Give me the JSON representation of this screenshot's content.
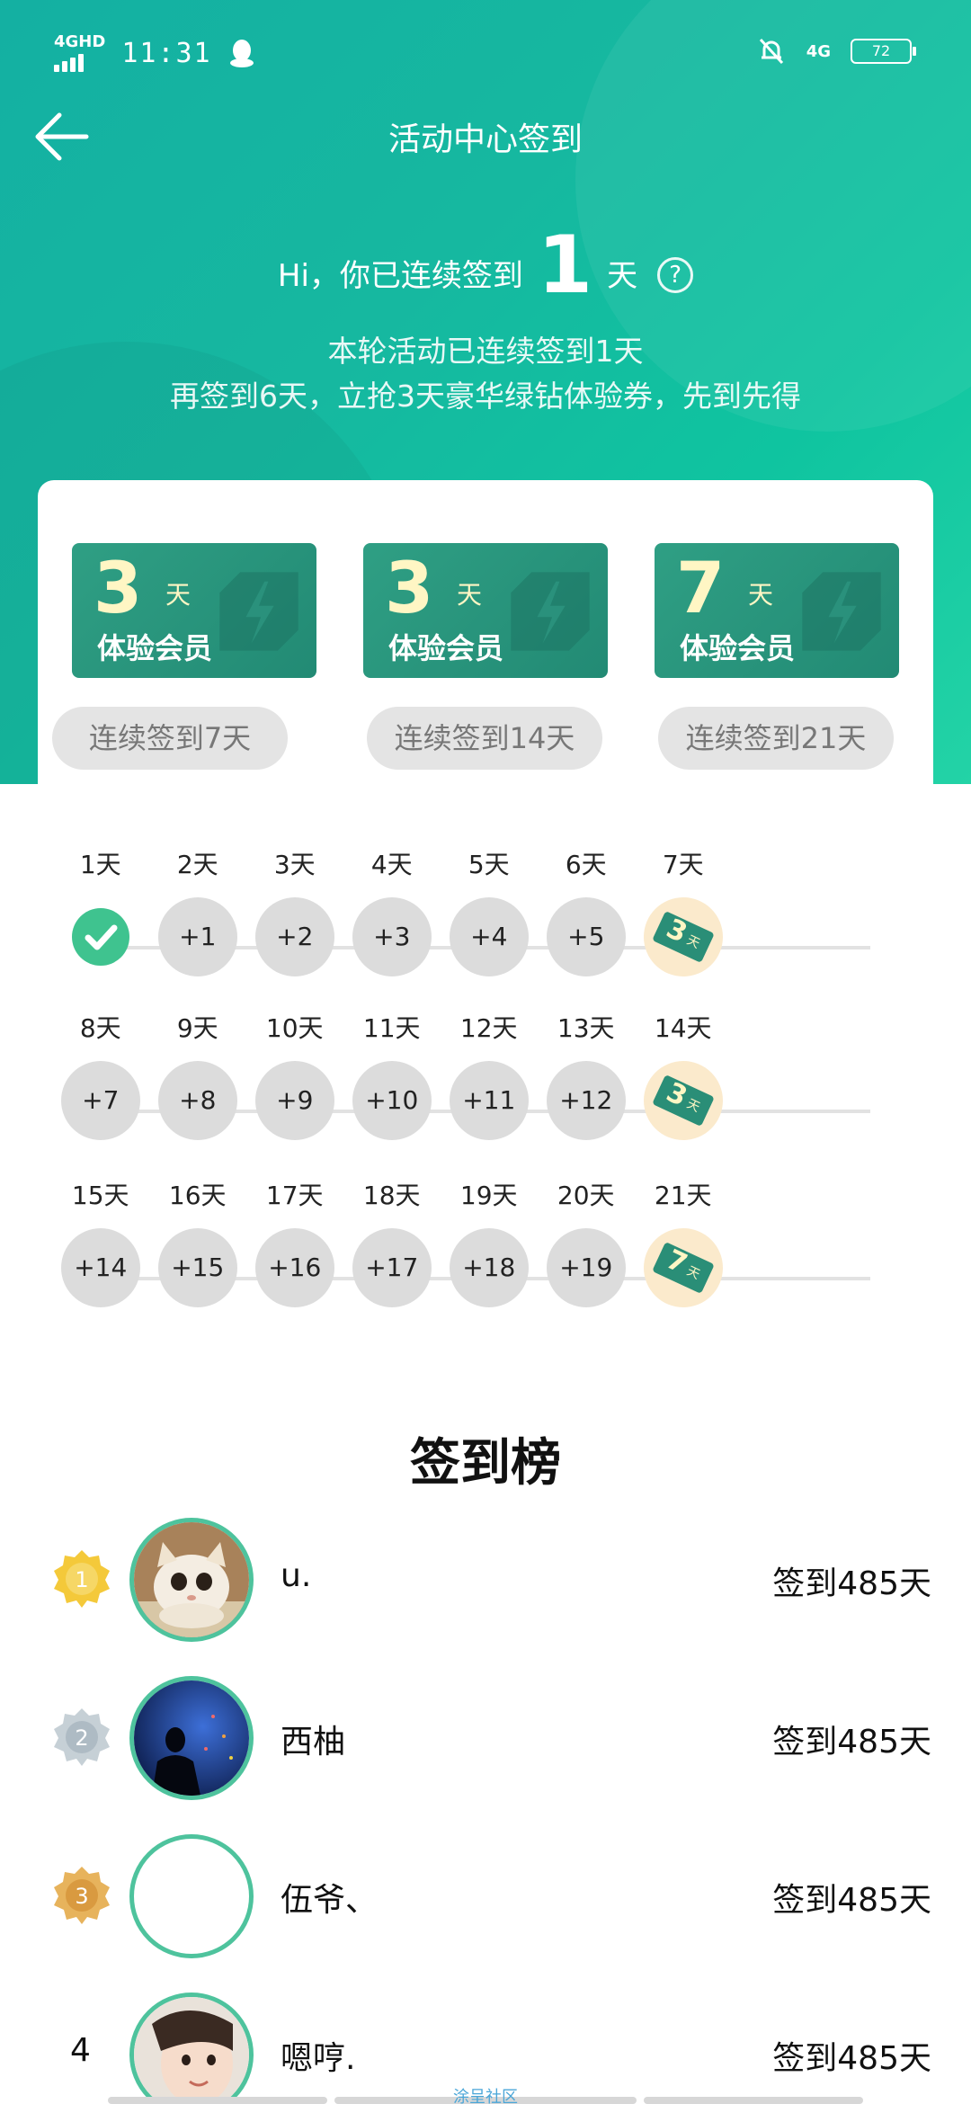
{
  "status_bar": {
    "network": "4GHD",
    "time": "11:31",
    "network_right": "4G",
    "battery": "72"
  },
  "header": {
    "title": "活动中心签到"
  },
  "greeting": {
    "prefix": "Hi，你已连续签到",
    "days": "1",
    "unit": "天",
    "help": "?"
  },
  "subtitle": {
    "line1": "本轮活动已连续签到1天",
    "line2": "再签到6天，立抢3天豪华绿钻体验券，先到先得"
  },
  "rewards": [
    {
      "days": "3",
      "unit": "天",
      "label": "体验会员",
      "requirement": "连续签到7天"
    },
    {
      "days": "3",
      "unit": "天",
      "label": "体验会员",
      "requirement": "连续签到14天"
    },
    {
      "days": "7",
      "unit": "天",
      "label": "体验会员",
      "requirement": "连续签到21天"
    }
  ],
  "calendar": {
    "rows": [
      [
        {
          "day": "1天",
          "value": "",
          "state": "done"
        },
        {
          "day": "2天",
          "value": "+1",
          "state": "pending"
        },
        {
          "day": "3天",
          "value": "+2",
          "state": "pending"
        },
        {
          "day": "4天",
          "value": "+3",
          "state": "pending"
        },
        {
          "day": "5天",
          "value": "+4",
          "state": "pending"
        },
        {
          "day": "6天",
          "value": "+5",
          "state": "pending"
        },
        {
          "day": "7天",
          "value": "3",
          "unit": "天",
          "state": "reward"
        }
      ],
      [
        {
          "day": "8天",
          "value": "+7",
          "state": "pending"
        },
        {
          "day": "9天",
          "value": "+8",
          "state": "pending"
        },
        {
          "day": "10天",
          "value": "+9",
          "state": "pending"
        },
        {
          "day": "11天",
          "value": "+10",
          "state": "pending"
        },
        {
          "day": "12天",
          "value": "+11",
          "state": "pending"
        },
        {
          "day": "13天",
          "value": "+12",
          "state": "pending"
        },
        {
          "day": "14天",
          "value": "3",
          "unit": "天",
          "state": "reward"
        }
      ],
      [
        {
          "day": "15天",
          "value": "+14",
          "state": "pending"
        },
        {
          "day": "16天",
          "value": "+15",
          "state": "pending"
        },
        {
          "day": "17天",
          "value": "+16",
          "state": "pending"
        },
        {
          "day": "18天",
          "value": "+17",
          "state": "pending"
        },
        {
          "day": "19天",
          "value": "+18",
          "state": "pending"
        },
        {
          "day": "20天",
          "value": "+19",
          "state": "pending"
        },
        {
          "day": "21天",
          "value": "7",
          "unit": "天",
          "state": "reward"
        }
      ]
    ]
  },
  "leaderboard": {
    "title": "签到榜",
    "entries": [
      {
        "rank": "1",
        "name": "u.",
        "days": "签到485天",
        "medal": "gold",
        "avatar": "cat-photo"
      },
      {
        "rank": "2",
        "name": "西柚",
        "days": "签到485天",
        "medal": "silver",
        "avatar": "silhouette-photo"
      },
      {
        "rank": "3",
        "name": "伍爷、",
        "days": "签到485天",
        "medal": "bronze",
        "avatar": "blank"
      },
      {
        "rank": "4",
        "name": "嗯哼.",
        "days": "签到485天",
        "medal": "none",
        "avatar": "child-photo"
      }
    ]
  },
  "bottom_bar": {
    "label": "涂呈社区"
  },
  "colors": {
    "brand_teal": "#14b0a2",
    "check_green": "#3fc38f",
    "voucher_green": "#2f9f84",
    "avatar_ring": "#4ec39d",
    "gold": "#f2c230",
    "silver": "#b8c4cc",
    "bronze": "#e0a84a"
  }
}
